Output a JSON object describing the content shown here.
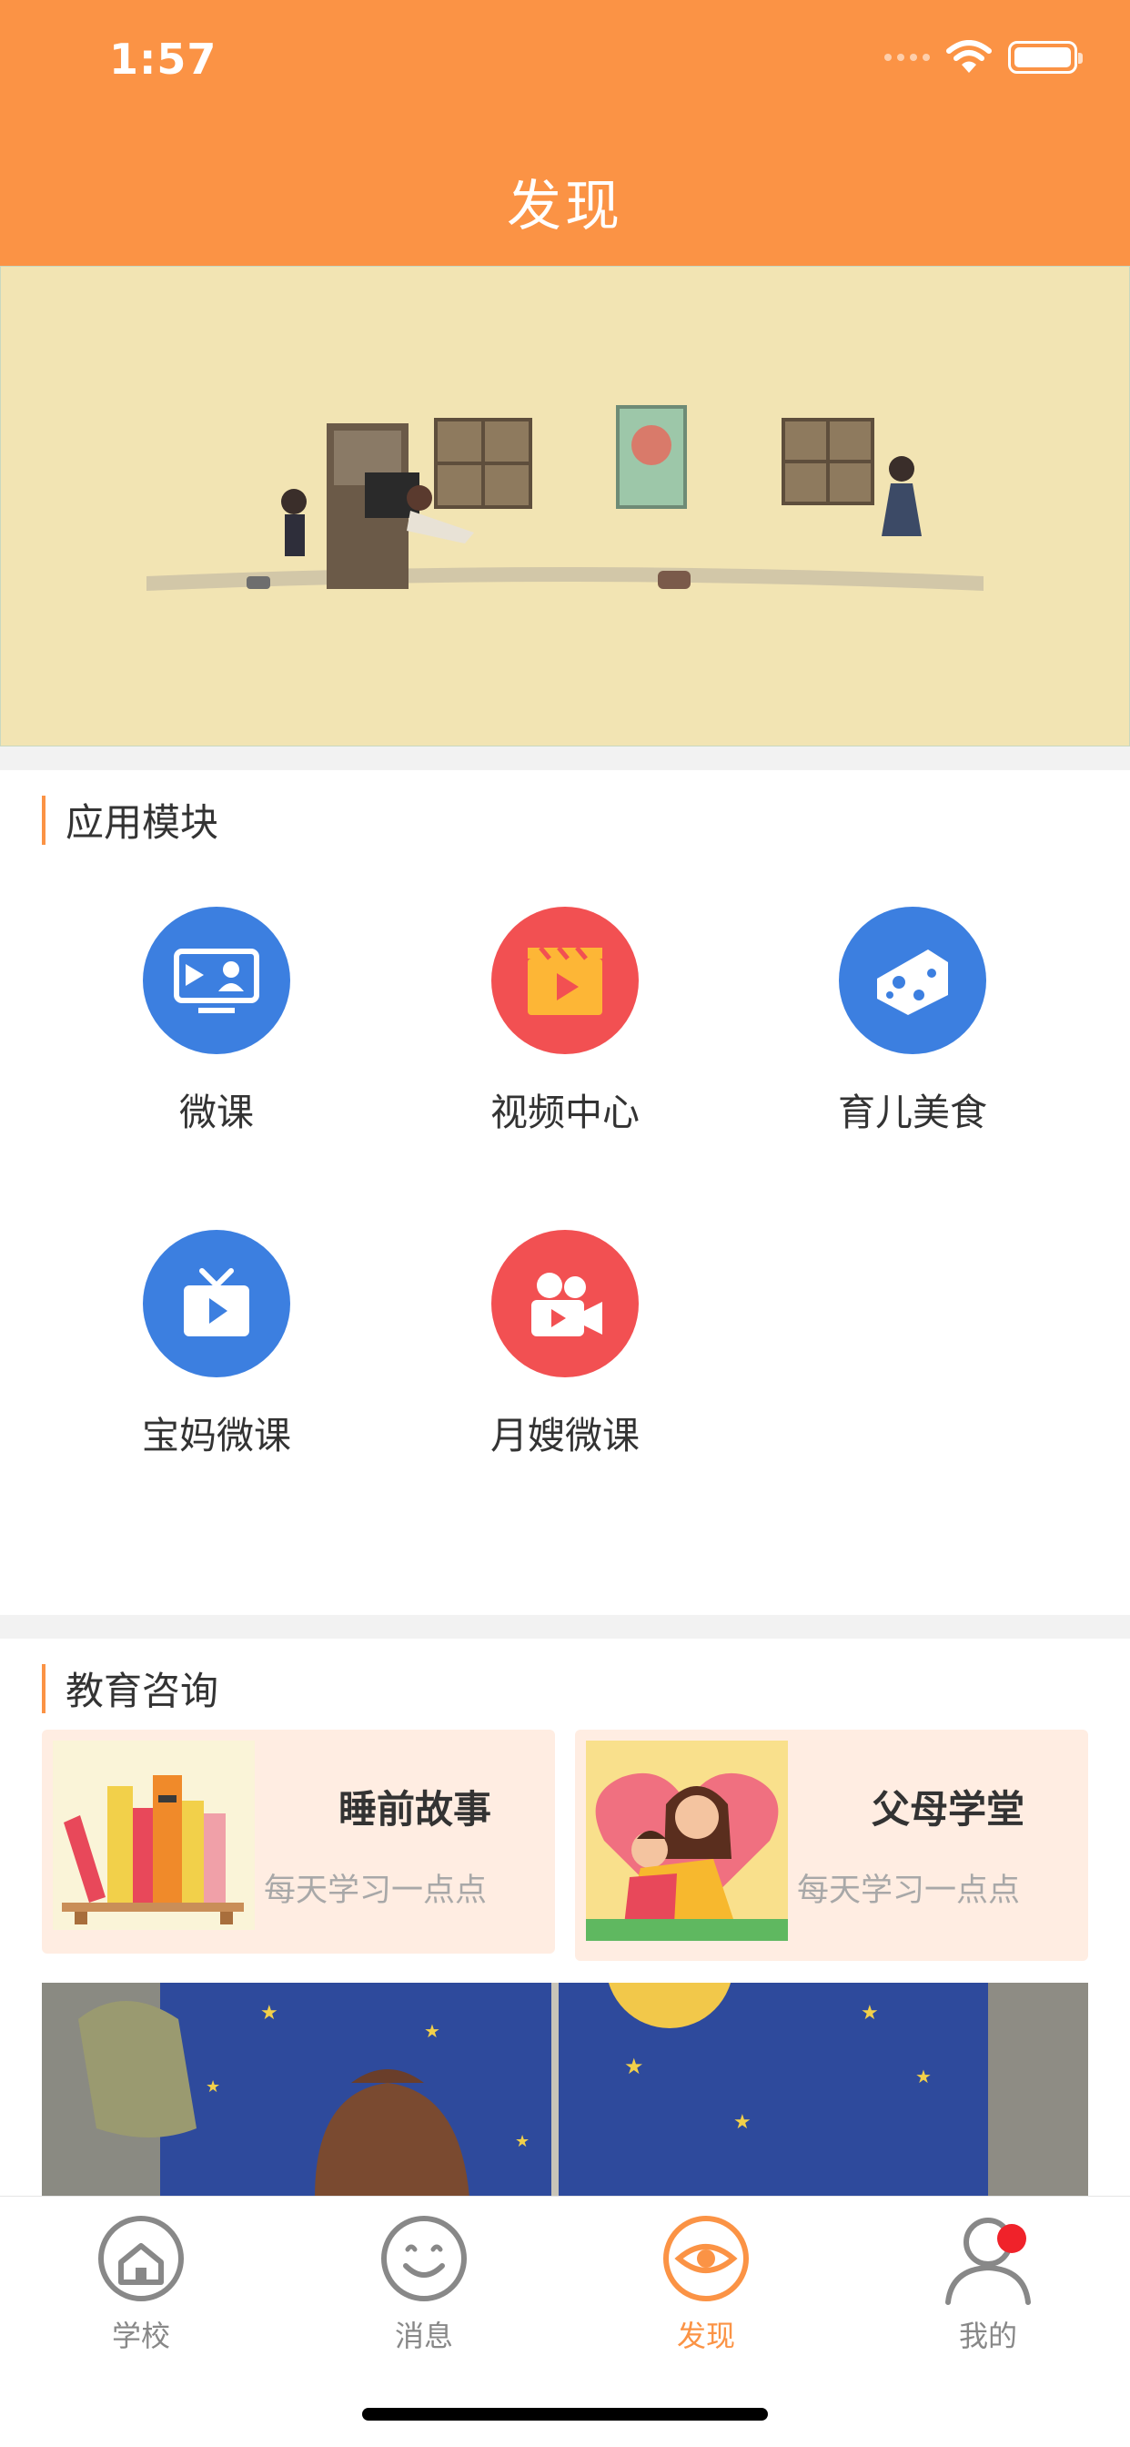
{
  "status_bar": {
    "time": "1:57"
  },
  "header": {
    "title": "发现"
  },
  "sections": {
    "modules_title": "应用模块",
    "consult_title": "教育咨询"
  },
  "modules": [
    {
      "label": "微课",
      "icon": "monitor-person-icon",
      "color": "#3C7FE0"
    },
    {
      "label": "视频中心",
      "icon": "film-play-icon",
      "color": "#F25052"
    },
    {
      "label": "育儿美食",
      "icon": "cheese-icon",
      "color": "#3C7FE0"
    },
    {
      "label": "宝妈微课",
      "icon": "tv-play-icon",
      "color": "#3C7FE0"
    },
    {
      "label": "月嫂微课",
      "icon": "video-camera-icon",
      "color": "#F25052"
    }
  ],
  "cards": [
    {
      "title": "睡前故事",
      "subtitle": "每天学习一点点"
    },
    {
      "title": "父母学堂",
      "subtitle": "每天学习一点点"
    }
  ],
  "tabbar": {
    "items": [
      {
        "label": "学校",
        "icon": "home-icon",
        "active": false
      },
      {
        "label": "消息",
        "icon": "smile-icon",
        "active": false
      },
      {
        "label": "发现",
        "icon": "eye-icon",
        "active": true
      },
      {
        "label": "我的",
        "icon": "person-icon",
        "active": false
      }
    ]
  },
  "colors": {
    "accent": "#FB9345",
    "blue": "#3C7FE0",
    "red": "#F25052",
    "card_bg": "#FFEDE2",
    "badge": "#F0222A"
  }
}
